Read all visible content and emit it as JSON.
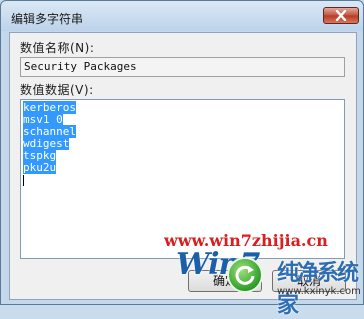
{
  "window": {
    "title": "编辑多字符串"
  },
  "fields": {
    "value_name_label": "数值名称(N):",
    "value_name": "Security Packages",
    "value_data_label": "数值数据(V):",
    "value_data_lines": [
      "kerberos",
      "msv1_0",
      "schannel",
      "wdigest",
      "tspkg",
      "pku2u"
    ]
  },
  "buttons": {
    "ok": "确定",
    "cancel": "取消"
  },
  "watermark": {
    "url": "www.win7zhijia.cn",
    "logo_text": "Win7",
    "chinese_text": "纯净系统家",
    "site": "www.kxinyk.com"
  },
  "colors": {
    "selection": "#3399ff",
    "close_button": "#c0523c",
    "watermark_red": "#d81e1e",
    "watermark_blue": "#1a5fa8"
  }
}
